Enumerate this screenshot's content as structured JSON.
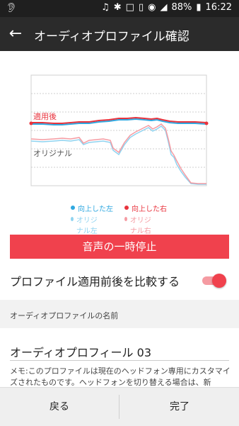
{
  "status_bar": {
    "left_icon": "ear-icon",
    "icons": [
      "headphones-icon",
      "bluetooth-icon",
      "nfc-icon",
      "vibrate-icon",
      "wifi-icon",
      "signal-icon"
    ],
    "battery": "88%",
    "time": "16:22"
  },
  "app_bar": {
    "title": "オーディオプロファイル確認"
  },
  "chart": {
    "label_after": "適用後",
    "label_original": "オリジナル",
    "colors": {
      "after_left": "#2fa8e0",
      "after_right": "#e8333d",
      "orig_left": "#8fd3f0",
      "orig_right": "#f59ba2"
    },
    "legend": [
      {
        "label": "向上した左",
        "color": "#2fa8e0"
      },
      {
        "label": "向上した右",
        "color": "#e8333d"
      },
      {
        "label": "オリジナル左",
        "color": "#8fd3f0"
      },
      {
        "label": "オリジナル右",
        "color": "#f59ba2"
      }
    ]
  },
  "pause_button": "音声の一時停止",
  "compare": {
    "label": "プロファイル適用前後を比較する",
    "enabled": true
  },
  "section_header": "オーディオプロファイルの名前",
  "profile_name": "オーディオプロフィール 03",
  "memo": "メモ:このプロファイルは現在のヘッドフォン専用にカスタマイズされたものです。ヘッドフォンを切り替える場合は、新",
  "bottom": {
    "back": "戻る",
    "done": "完了"
  }
}
